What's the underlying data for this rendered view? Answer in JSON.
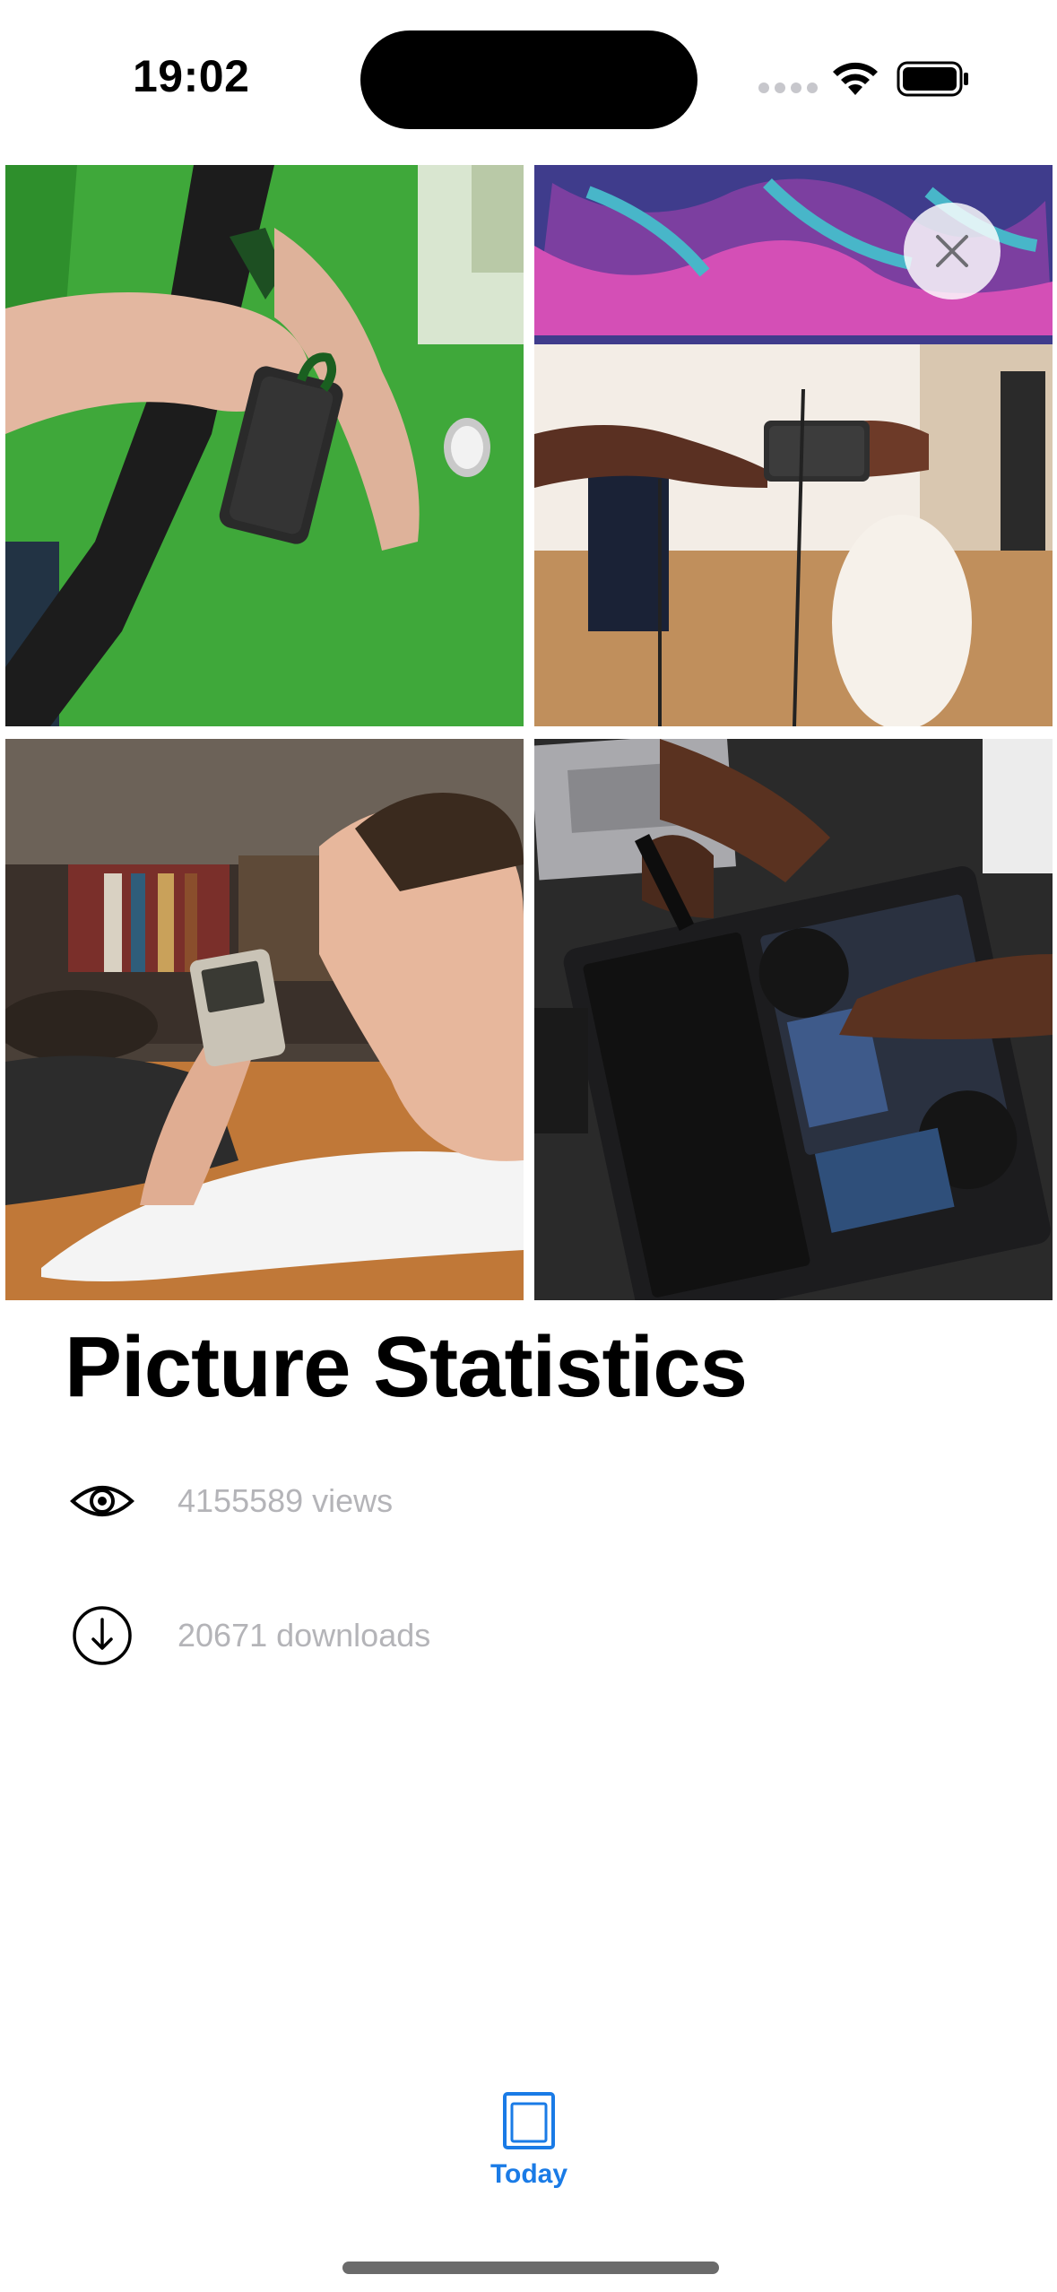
{
  "status_bar": {
    "time": "19:02"
  },
  "gallery": {
    "photos": [
      {
        "name": "person-holding-ssd-photo"
      },
      {
        "name": "ssd-with-monitor-photo"
      },
      {
        "name": "handheld-console-photo"
      },
      {
        "name": "laptop-repair-photo"
      }
    ],
    "close_icon": "close-icon"
  },
  "stats": {
    "title": "Picture Statistics",
    "views": {
      "icon": "eye-icon",
      "text": "4155589 views"
    },
    "downloads": {
      "icon": "download-icon",
      "text": "20671 downloads"
    }
  },
  "tab_bar": {
    "tabs": [
      {
        "label": "Today",
        "icon": "today-icon",
        "selected": true
      }
    ],
    "accent_color": "#1a7be6"
  }
}
